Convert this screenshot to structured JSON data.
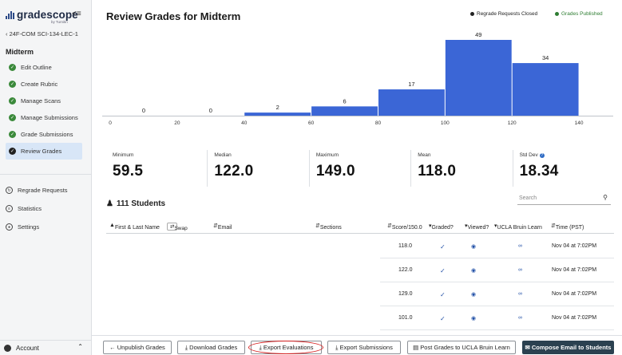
{
  "sidebar": {
    "logo_text": "gradescope",
    "logo_sub": "by Turnitin",
    "course": "24F-COM SCI-134-LEC-1",
    "assignment": "Midterm",
    "steps": [
      {
        "label": "Edit Outline",
        "icon": "check-circle-icon"
      },
      {
        "label": "Create Rubric",
        "icon": "check-circle-icon"
      },
      {
        "label": "Manage Scans",
        "icon": "check-circle-icon"
      },
      {
        "label": "Manage Submissions",
        "icon": "check-circle-icon"
      },
      {
        "label": "Grade Submissions",
        "icon": "check-circle-icon"
      },
      {
        "label": "Review Grades",
        "icon": "check-circle-icon",
        "active": true
      }
    ],
    "tools": [
      {
        "label": "Regrade Requests",
        "icon": "regrade-icon"
      },
      {
        "label": "Statistics",
        "icon": "statistics-icon"
      },
      {
        "label": "Settings",
        "icon": "settings-icon"
      }
    ],
    "account": "Account"
  },
  "header": {
    "title": "Review Grades for Midterm",
    "legend_regrade": "Regrade Requests Closed",
    "legend_published": "Grades Published"
  },
  "chart_data": {
    "type": "bar",
    "x_ticks": [
      0,
      20,
      40,
      60,
      80,
      100,
      120,
      140
    ],
    "bins": [
      {
        "from": 0,
        "to": 20,
        "value": 0
      },
      {
        "from": 20,
        "to": 40,
        "value": 0
      },
      {
        "from": 40,
        "to": 60,
        "value": 2
      },
      {
        "from": 60,
        "to": 80,
        "value": 6
      },
      {
        "from": 80,
        "to": 100,
        "value": 17
      },
      {
        "from": 100,
        "to": 120,
        "value": 49
      },
      {
        "from": 120,
        "to": 140,
        "value": 34
      }
    ],
    "xlim": [
      0,
      150
    ],
    "ylim": [
      0,
      49
    ],
    "color": "#3b66d6"
  },
  "stats": [
    {
      "label": "Minimum",
      "value": "59.5"
    },
    {
      "label": "Median",
      "value": "122.0"
    },
    {
      "label": "Maximum",
      "value": "149.0"
    },
    {
      "label": "Mean",
      "value": "118.0"
    },
    {
      "label": "Std Dev",
      "value": "18.34",
      "help": true
    }
  ],
  "students": {
    "count_label": "111 Students",
    "search_placeholder": "Search"
  },
  "table": {
    "col_name": "First & Last Name",
    "swap": "Swap",
    "col_email": "Email",
    "col_sections": "Sections",
    "col_score": "Score/150.0",
    "col_graded": "Graded?",
    "col_viewed": "Viewed?",
    "col_lms": "UCLA Bruin Learn",
    "col_time": "Time (PST)",
    "rows": [
      {
        "score": "118.0",
        "time": "Nov 04 at 7:02PM"
      },
      {
        "score": "122.0",
        "time": "Nov 04 at 7:02PM"
      },
      {
        "score": "129.0",
        "time": "Nov 04 at 7:02PM"
      },
      {
        "score": "101.0",
        "time": "Nov 04 at 7:02PM"
      }
    ]
  },
  "footer": {
    "unpublish": "Unpublish Grades",
    "download": "Download Grades",
    "export_eval": "Export Evaluations",
    "export_sub": "Export Submissions",
    "post_grades": "Post Grades to UCLA Bruin Learn",
    "compose": "Compose Email to Students"
  }
}
